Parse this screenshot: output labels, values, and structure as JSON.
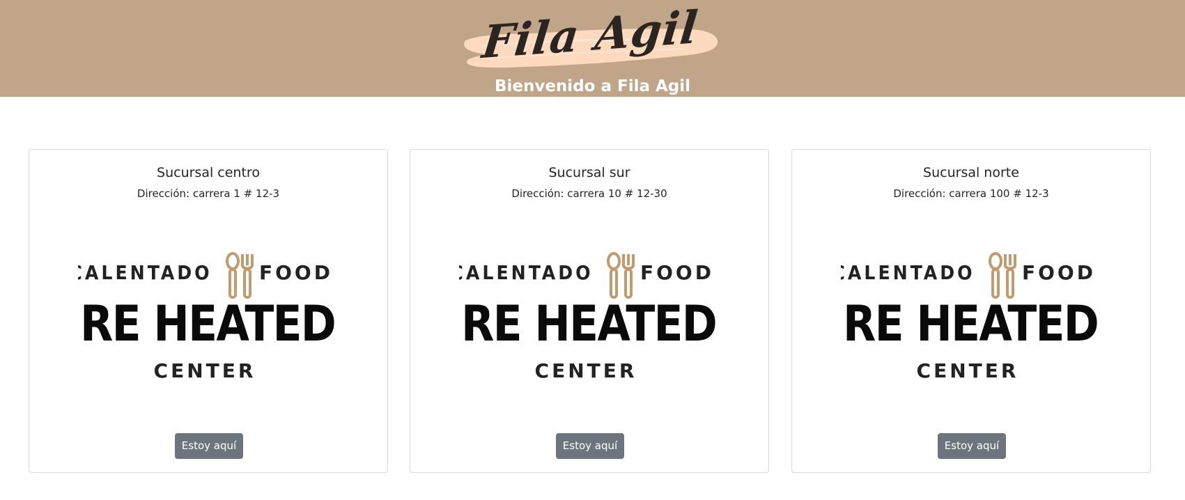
{
  "header": {
    "logo_text": "Fila Agil",
    "welcome": "Bienvenido a Fila Agil"
  },
  "colors": {
    "header_bg": "#c0a588",
    "brush": "#fdd9be",
    "utensil": "#c29a6e",
    "button": "#6c757d"
  },
  "branch_logo": {
    "top_left": "CALENTADO",
    "top_right": "FOOD",
    "main": "RE HEATED",
    "bottom": "CENTER",
    "icon": "spoon-fork-icon"
  },
  "branches": [
    {
      "name": "Sucursal centro",
      "address": "Dirección: carrera 1 # 12-3",
      "button": "Estoy aquí"
    },
    {
      "name": "Sucursal sur",
      "address": "Dirección: carrera 10 # 12-30",
      "button": "Estoy aquí"
    },
    {
      "name": "Sucursal norte",
      "address": "Dirección: carrera 100 # 12-3",
      "button": "Estoy aquí"
    }
  ]
}
